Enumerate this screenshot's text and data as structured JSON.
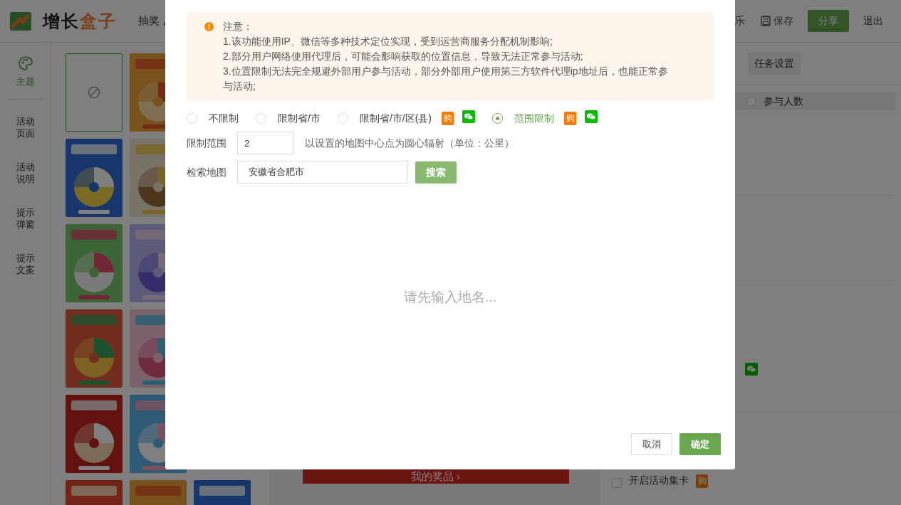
{
  "header": {
    "logo_text_dark": "增长",
    "logo_text_accent": "盒子",
    "nav": [
      {
        "label": "抽奖"
      }
    ],
    "right_cut": "乐",
    "save": "保存",
    "share": "分享",
    "logout": "退出"
  },
  "sidebar": {
    "items": [
      {
        "label": "主题",
        "selected": true
      },
      {
        "label": "活动页面",
        "selected": false
      },
      {
        "label": "活动说明",
        "selected": false
      },
      {
        "label": "提示弹窗",
        "selected": false
      },
      {
        "label": "提示文案",
        "selected": false
      }
    ]
  },
  "template_rows": [
    {
      "cards": [
        {
          "kind": "none",
          "selected": true
        },
        {
          "kind": "picture",
          "selected": false
        }
      ]
    },
    {
      "cards": [
        {
          "kind": "picture",
          "selected": false
        },
        {
          "kind": "picture",
          "selected": false
        }
      ]
    },
    {
      "cards": [
        {
          "kind": "picture",
          "selected": false
        },
        {
          "kind": "picture",
          "selected": false
        }
      ]
    },
    {
      "cards": [
        {
          "kind": "picture",
          "selected": false
        },
        {
          "kind": "picture",
          "selected": false
        }
      ]
    },
    {
      "cards": [
        {
          "kind": "picture",
          "selected": false
        },
        {
          "kind": "picture",
          "selected": false
        }
      ]
    },
    {
      "cards": [
        {
          "kind": "picture",
          "selected": false
        },
        {
          "kind": "picture",
          "selected": false
        },
        {
          "kind": "picture",
          "selected": false
        }
      ]
    }
  ],
  "preview": {
    "prize_button": "我的奖品 ›"
  },
  "right_panel": {
    "tab": "任务设置",
    "option": {
      "label": "参与人数",
      "selected": false
    },
    "collect_cards": {
      "label": "开启活动集卡",
      "checked": false,
      "badge": "购"
    }
  },
  "modal": {
    "notice": [
      "注意：",
      "1.该功能使用IP、微信等多种技术定位实现，受到运营商服务分配机制影响;",
      "2.部分用户网络使用代理后，可能会影响获取的位置信息，导致无法正常参与活动;",
      "3.位置限制无法完全规避外部用户参与活动，部分外部用户使用第三方软件代理ip地址后，也能正常参与活动;"
    ],
    "options": [
      {
        "label": "不限制",
        "selected": false,
        "wechat": false
      },
      {
        "label": "限制省/市",
        "selected": false,
        "wechat": false
      },
      {
        "label": "限制省/市/区(县)",
        "selected": false,
        "badge": "购",
        "wechat": true
      },
      {
        "label": "范围限制",
        "selected": true,
        "badge": "购",
        "wechat": true
      }
    ],
    "range": {
      "label": "限制范围",
      "value": "2",
      "hint": "以设置的地图中心点为圆心辐射（单位：公里）"
    },
    "search": {
      "label": "检索地图",
      "value": "安徽省合肥市",
      "button": "搜索"
    },
    "map_message": "请先输入地名...",
    "cancel": "取消",
    "confirm": "确定"
  }
}
